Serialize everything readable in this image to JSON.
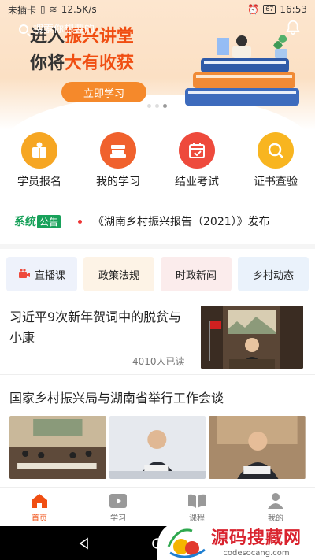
{
  "status_bar": {
    "carrier": "未插卡",
    "speed": "12.5K/s",
    "battery": "67",
    "time": "16:53"
  },
  "search": {
    "placeholder": "搜索你想要的..."
  },
  "banner": {
    "title_part1": "进入",
    "title_highlight1": "振兴讲堂",
    "title_part2": "你将",
    "title_highlight2": "大有收获",
    "button": "立即学习"
  },
  "quick_menu": [
    {
      "label": "学员报名",
      "icon": "book-person-icon",
      "color": "#f6a623"
    },
    {
      "label": "我的学习",
      "icon": "books-icon",
      "color": "#f0612d"
    },
    {
      "label": "结业考试",
      "icon": "calendar-check-icon",
      "color": "#ee4a3c"
    },
    {
      "label": "证书查验",
      "icon": "search-icon",
      "color": "#f8b520"
    }
  ],
  "notice": {
    "label": "系统",
    "badge": "公告",
    "text": "《湖南乡村振兴报告（2021）》发布"
  },
  "tabs": [
    "直播课",
    "政策法规",
    "时政新闻",
    "乡村动态"
  ],
  "news": [
    {
      "title": "习近平9次新年贺词中的脱贫与小康",
      "reads": "4010人已读"
    },
    {
      "title": "国家乡村振兴局与湖南省举行工作会谈"
    }
  ],
  "bottom_nav": [
    {
      "label": "首页",
      "icon": "home-icon",
      "active": true
    },
    {
      "label": "学习",
      "icon": "play-icon"
    },
    {
      "label": "课程",
      "icon": "open-book-icon"
    },
    {
      "label": "我的",
      "icon": "person-icon"
    }
  ],
  "watermark": {
    "title": "源码搜藏网",
    "url": "codesocang.com"
  },
  "colors": {
    "accent": "#f04e12",
    "green": "#18a15a"
  }
}
